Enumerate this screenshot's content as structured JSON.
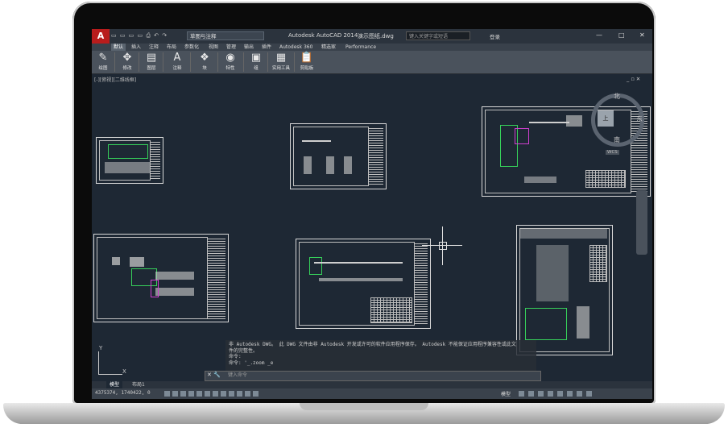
{
  "titlebar": {
    "logo": "A",
    "workspace": "草图与注释",
    "app_title": "Autodesk AutoCAD 2014",
    "file_title": "演示图纸.dwg",
    "search_placeholder": "键入关键字或短语",
    "login": "登录",
    "min": "—",
    "max": "□",
    "close": "✕"
  },
  "ribbon_tabs": [
    "默认",
    "插入",
    "注释",
    "布局",
    "参数化",
    "视图",
    "管理",
    "输出",
    "插件",
    "Autodesk 360",
    "精选家",
    "Performance"
  ],
  "ribbon_buttons": [
    {
      "label": "绘图",
      "icon": "✎"
    },
    {
      "label": "修改",
      "icon": "✥"
    },
    {
      "label": "图层",
      "icon": "▤"
    },
    {
      "label": "注释",
      "icon": "A"
    },
    {
      "label": "块",
      "icon": "❖"
    },
    {
      "label": "特性",
      "icon": "◉"
    },
    {
      "label": "组",
      "icon": "▣"
    },
    {
      "label": "实用工具",
      "icon": "▦"
    },
    {
      "label": "剪贴板",
      "icon": "📋"
    }
  ],
  "viewport": {
    "label": "[-][俯视][二维线框]",
    "controls": "_ ▫ ✕"
  },
  "viewcube": {
    "north": "北",
    "south": "南",
    "east": "东",
    "face": "上",
    "wcs": "WCS"
  },
  "ucs": {
    "x": "X",
    "y": "Y"
  },
  "command": {
    "history": [
      "非 Autodesk DWG。 此 DWG 文件由非 Autodesk 开发或许可的软件应用程序保存。 Autodesk 不能保证应用程序兼容性或此文",
      "件的完整性。",
      "命令:",
      "命令: '_.zoom _e"
    ],
    "placeholder": "键入命令",
    "close_icon": "✕ 🔧"
  },
  "layout_tabs": [
    "模型",
    "布局1"
  ],
  "status": {
    "coords": "4375374, 1740422, 0",
    "model": "模型"
  }
}
